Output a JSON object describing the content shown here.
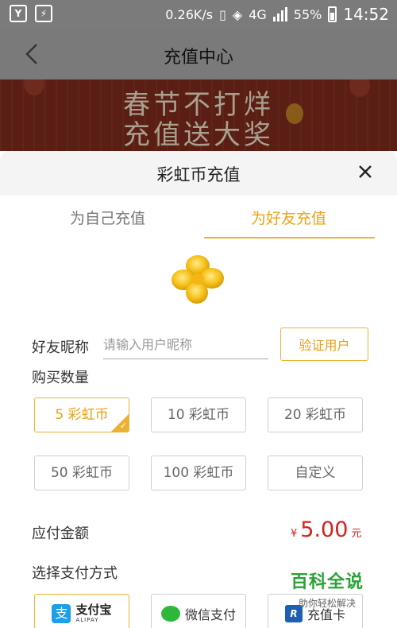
{
  "status_bar": {
    "net_speed": "0.26K/s",
    "network": "4G",
    "battery": "55%",
    "time": "14:52"
  },
  "nav": {
    "title": "充值中心"
  },
  "banner": {
    "line1": "春节不打烊",
    "line2": "充值送大奖"
  },
  "sheet": {
    "title": "彩虹币充值",
    "tabs": [
      {
        "label": "为自己充值",
        "active": false
      },
      {
        "label": "为好友充值",
        "active": true
      }
    ],
    "nickname_label": "好友昵称",
    "nickname_placeholder": "请输入用户昵称",
    "verify_label": "验证用户",
    "quantity_label": "购买数量",
    "options": [
      {
        "label": "5 彩虹币",
        "selected": true
      },
      {
        "label": "10 彩虹币",
        "selected": false
      },
      {
        "label": "20 彩虹币",
        "selected": false
      },
      {
        "label": "50 彩虹币",
        "selected": false
      },
      {
        "label": "100 彩虹币",
        "selected": false
      },
      {
        "label": "自定义",
        "selected": false
      }
    ],
    "amount_label": "应付金额",
    "amount_symbol": "¥",
    "amount_value": "5.00",
    "amount_unit": "元",
    "payment_label": "选择支付方式",
    "payments": [
      {
        "name": "支付宝",
        "sub": "ALIPAY",
        "icon": "alipay-icon",
        "selected": true
      },
      {
        "name": "微信支付",
        "icon": "wechat-pay-icon",
        "selected": false
      },
      {
        "name": "充值卡",
        "icon": "recharge-card-icon",
        "selected": false
      }
    ]
  },
  "watermark": {
    "main": "百科全说",
    "sub": "助你轻松解决"
  },
  "colors": {
    "accent": "#ebb135",
    "price": "#d0231b",
    "overlay": "#7a7a7a"
  }
}
